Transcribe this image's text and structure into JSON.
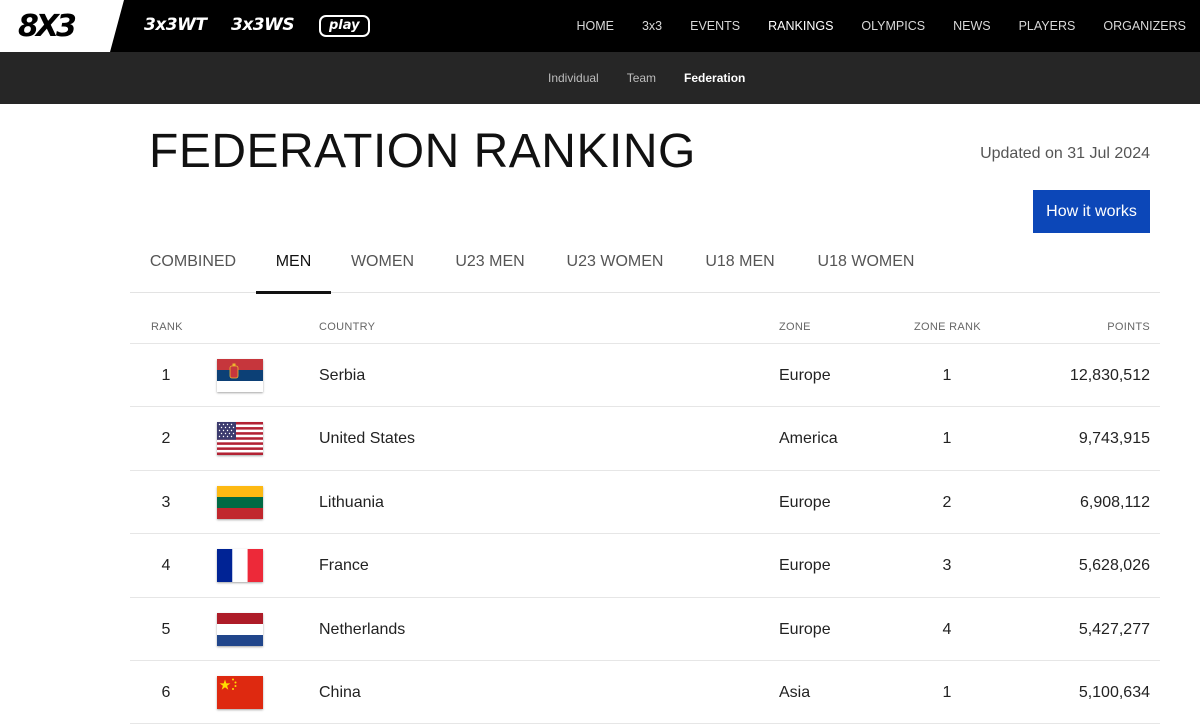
{
  "header": {
    "logo": "8X3",
    "brand_wt": "3x3WT",
    "brand_ws": "3x3WS",
    "brand_play": "play",
    "nav": [
      "HOME",
      "3x3",
      "EVENTS",
      "RANKINGS",
      "OLYMPICS",
      "NEWS",
      "PLAYERS",
      "ORGANIZERS"
    ],
    "active_nav": "RANKINGS"
  },
  "subnav": {
    "items": [
      "Individual",
      "Team",
      "Federation"
    ],
    "active": "Federation"
  },
  "page": {
    "title": "FEDERATION RANKING",
    "updated": "Updated on 31 Jul 2024",
    "how_it_works": "How it works"
  },
  "tabs": {
    "items": [
      "COMBINED",
      "MEN",
      "WOMEN",
      "U23 MEN",
      "U23 WOMEN",
      "U18 MEN",
      "U18 WOMEN"
    ],
    "active": "MEN"
  },
  "table": {
    "columns": [
      "RANK",
      "COUNTRY",
      "ZONE",
      "ZONE RANK",
      "POINTS"
    ],
    "rows": [
      {
        "rank": "1",
        "flag": "serbia-flag",
        "country": "Serbia",
        "zone": "Europe",
        "zone_rank": "1",
        "points": "12,830,512"
      },
      {
        "rank": "2",
        "flag": "united-states-flag",
        "country": "United States",
        "zone": "America",
        "zone_rank": "1",
        "points": "9,743,915"
      },
      {
        "rank": "3",
        "flag": "lithuania-flag",
        "country": "Lithuania",
        "zone": "Europe",
        "zone_rank": "2",
        "points": "6,908,112"
      },
      {
        "rank": "4",
        "flag": "france-flag",
        "country": "France",
        "zone": "Europe",
        "zone_rank": "3",
        "points": "5,628,026"
      },
      {
        "rank": "5",
        "flag": "netherlands-flag",
        "country": "Netherlands",
        "zone": "Europe",
        "zone_rank": "4",
        "points": "5,427,277"
      },
      {
        "rank": "6",
        "flag": "china-flag",
        "country": "China",
        "zone": "Asia",
        "zone_rank": "1",
        "points": "5,100,634"
      }
    ]
  },
  "colors": {
    "topbar": "#000000",
    "subbar": "#262626",
    "accent": "#0c47b8"
  }
}
